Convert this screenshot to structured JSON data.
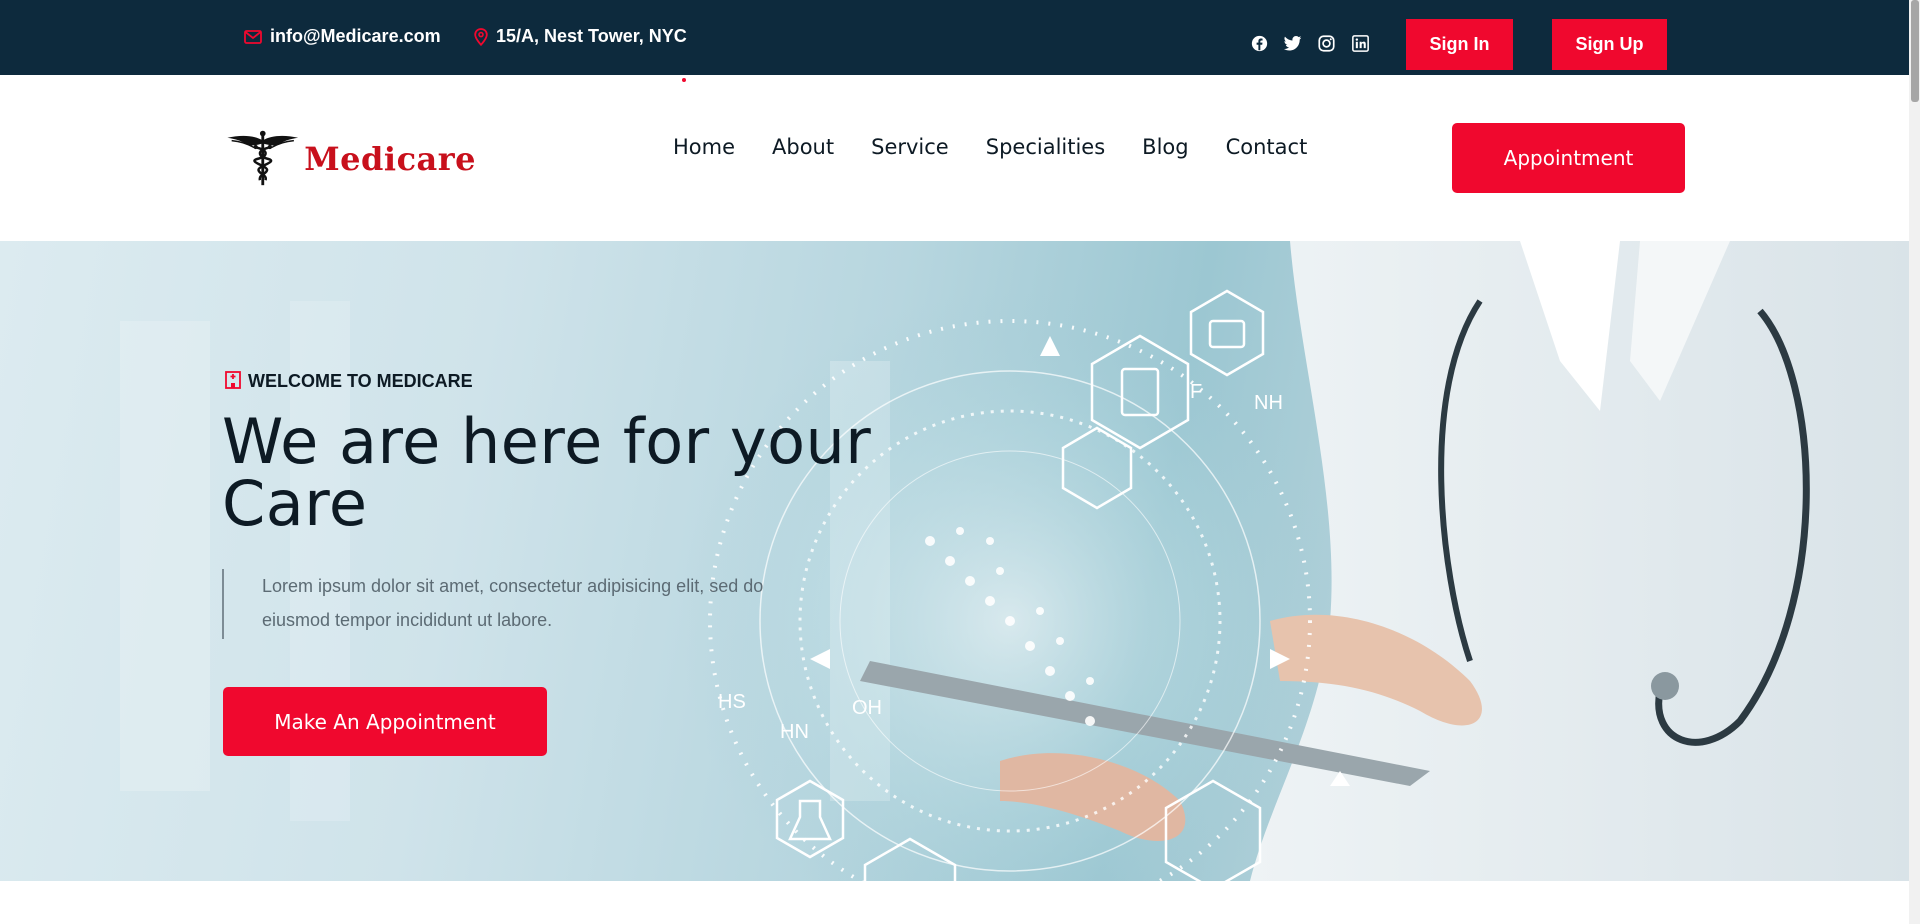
{
  "topbar": {
    "email": "info@Medicare.com",
    "address": "15/A, Nest Tower, NYC",
    "social": [
      "facebook-icon",
      "twitter-icon",
      "instagram-icon",
      "linkedin-icon"
    ],
    "sign_in": "Sign In",
    "sign_up": "Sign Up"
  },
  "header": {
    "logo_text": "Medicare",
    "nav": [
      "Home",
      "About",
      "Service",
      "Specialities",
      "Blog",
      "Contact"
    ],
    "appointment": "Appointment"
  },
  "hero": {
    "eyebrow": "WELCOME TO MEDICARE",
    "title": "We are here for your Care",
    "lead": "Lorem ipsum dolor sit amet, consectetur adipisicing elit, sed do eiusmod tempor incididunt ut labore.",
    "cta": "Make An Appointment",
    "art_labels": {
      "hs": "HS",
      "hn": "HN",
      "oh": "OH",
      "nh": "NH",
      "f": "F"
    }
  },
  "colors": {
    "topbar_bg": "#0d2a3d",
    "accent": "#f0082e",
    "text_dark": "#0d1a24",
    "text_muted": "#5c6b74"
  }
}
